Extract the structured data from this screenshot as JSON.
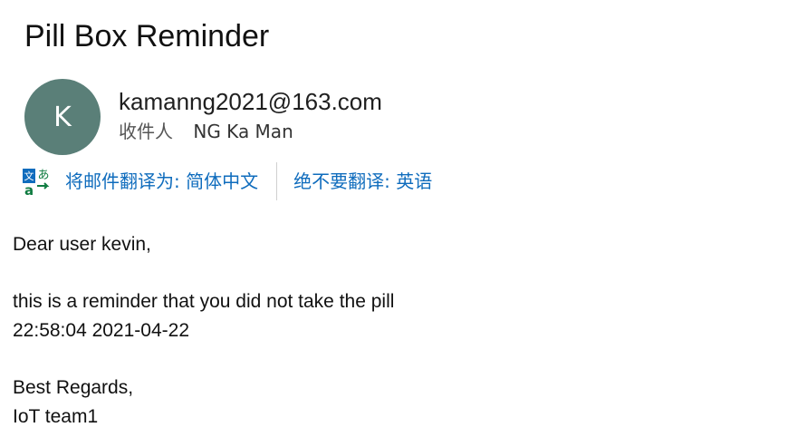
{
  "email": {
    "subject": "Pill Box Reminder",
    "avatar_initial": "K",
    "sender": "kamanng2021@163.com",
    "recipient_label": "收件人",
    "recipient_name": "NG Ka Man"
  },
  "translate": {
    "icon": "translate-icon",
    "translate_link": "将邮件翻译为: 简体中文",
    "never_translate_link": "绝不要翻译: 英语"
  },
  "message": {
    "greeting": "Dear user kevin,",
    "line1": "this is a reminder that you did not take the pill",
    "line2": "22:58:04 2021-04-22",
    "closing": "Best Regards,",
    "signature": "IoT team1"
  },
  "colors": {
    "avatar_bg": "#5a7f78",
    "link": "#0f6cbd"
  }
}
